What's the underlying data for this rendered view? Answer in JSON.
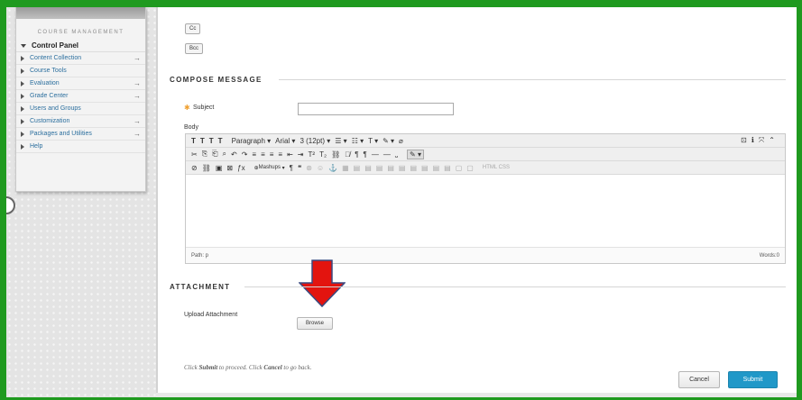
{
  "sidebar": {
    "title": "COURSE MANAGEMENT",
    "control_panel": "Control Panel",
    "items": [
      {
        "label": "Content Collection",
        "has_arrow": true
      },
      {
        "label": "Course Tools",
        "has_arrow": false
      },
      {
        "label": "Evaluation",
        "has_arrow": true
      },
      {
        "label": "Grade Center",
        "has_arrow": true
      },
      {
        "label": "Users and Groups",
        "has_arrow": false
      },
      {
        "label": "Customization",
        "has_arrow": true
      },
      {
        "label": "Packages and Utilities",
        "has_arrow": true
      },
      {
        "label": "Help",
        "has_arrow": false
      }
    ],
    "arrow_glyph": "→"
  },
  "recipients": {
    "cc_label": "Cc",
    "bcc_label": "Bcc"
  },
  "compose": {
    "section_title": "COMPOSE MESSAGE",
    "subject_label": "Subject",
    "subject_value": "",
    "body_label": "Body",
    "required_mark": "✱"
  },
  "editor": {
    "row1": {
      "format_icons": [
        "T",
        "T",
        "T",
        "T"
      ],
      "paragraph": "Paragraph",
      "font": "Arial",
      "size": "3 (12pt)",
      "list_icons": [
        "☰ ▾",
        "☷ ▾",
        "T ▾",
        "✎ ▾",
        "⌀"
      ],
      "right_icons": [
        "⊡",
        "ℹ",
        "⤧",
        "⌃"
      ]
    },
    "row2": {
      "icons": [
        "✂",
        "⎘",
        "⎗",
        "⌕",
        "↶",
        "↷",
        "≡",
        "≡",
        "≡",
        "≡",
        "⇤",
        "⇥",
        "T²",
        "T₂",
        "⛓",
        "⛓̸",
        "¶",
        "¶",
        "—",
        "—",
        "⎵"
      ],
      "highlight_icon": "✎ ▾"
    },
    "row3": {
      "icons": [
        "⊘",
        "⛓",
        "▣",
        "⊠",
        "ƒx"
      ],
      "mashups": "Mashups",
      "pilcrow": "¶",
      "quote": "❝",
      "more_icons": [
        "⊛",
        "☺",
        "⚓",
        "▦",
        "▤",
        "▤",
        "▤",
        "▤",
        "▤",
        "▤",
        "▤",
        "▤",
        "▤",
        "▢",
        "▢"
      ],
      "html_label": "HTML CSS"
    },
    "path_label": "Path: p",
    "words_label": "Words:0"
  },
  "attachment": {
    "section_title": "ATTACHMENT",
    "upload_label": "Upload Attachment",
    "browse_label": "Browse"
  },
  "footer": {
    "instruction_pre": "Click ",
    "submit_word": "Submit",
    "instruction_mid": " to proceed. Click ",
    "cancel_word": "Cancel",
    "instruction_post": " to go back.",
    "cancel_label": "Cancel",
    "submit_label": "Submit"
  },
  "colors": {
    "frame_border": "#1f9a1f",
    "submit_blue": "#2098c8",
    "annotation_arrow": "#e3140f",
    "link_blue": "#2c6f9e"
  }
}
